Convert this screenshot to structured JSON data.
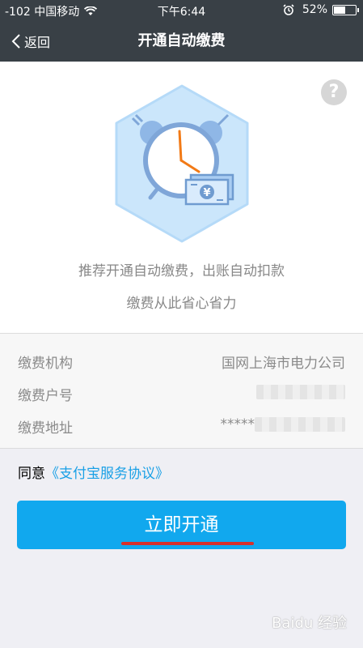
{
  "status_bar": {
    "signal_carrier": "-102 中国移动",
    "time": "下午6:44",
    "battery_percent": "52%",
    "battery_level": 0.52
  },
  "nav": {
    "back_label": "返回",
    "title": "开通自动缴费"
  },
  "hero": {
    "help_label": "?",
    "currency_symbol": "¥",
    "promo_line1": "推荐开通自动缴费，出账自动扣款",
    "promo_line2": "缴费从此省心省力"
  },
  "info": {
    "rows": [
      {
        "label": "缴费机构",
        "value": "国网上海市电力公司"
      },
      {
        "label": "缴费户号",
        "value": ""
      },
      {
        "label": "缴费地址",
        "value": "*****"
      }
    ]
  },
  "agreement": {
    "prefix": "同意",
    "link": "《支付宝服务协议》"
  },
  "actions": {
    "activate_label": "立即开通"
  },
  "watermark": "Baidu 经验",
  "colors": {
    "nav_bg": "#394046",
    "primary_button": "#11a8ee",
    "link": "#1aa0e6",
    "underline_mark": "#d8302a"
  }
}
